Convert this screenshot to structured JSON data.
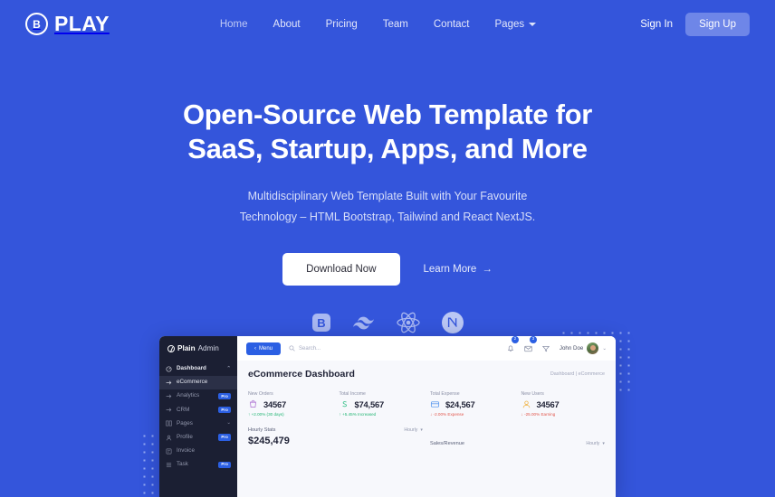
{
  "navbar": {
    "brand_mark": "B",
    "brand_text": "PLAY",
    "links": [
      {
        "label": "Home",
        "active": true
      },
      {
        "label": "About",
        "active": false
      },
      {
        "label": "Pricing",
        "active": false
      },
      {
        "label": "Team",
        "active": false
      },
      {
        "label": "Contact",
        "active": false
      },
      {
        "label": "Pages",
        "active": false,
        "has_caret": true
      }
    ],
    "sign_in": "Sign In",
    "sign_up": "Sign Up"
  },
  "hero": {
    "heading_line1": "Open-Source Web Template for",
    "heading_line2": "SaaS, Startup, Apps, and More",
    "sub_line1": "Multidisciplinary Web Template Built with Your Favourite",
    "sub_line2": "Technology – HTML Bootstrap, Tailwind and React NextJS.",
    "btn_download": "Download Now",
    "btn_learn": "Learn More",
    "btn_learn_arrow": "→",
    "tech_icons": [
      {
        "name": "bootstrap-icon",
        "glyph": "B"
      },
      {
        "name": "tailwind-icon",
        "glyph": "~"
      },
      {
        "name": "react-icon",
        "glyph": "atom"
      },
      {
        "name": "nextjs-icon",
        "glyph": "N"
      }
    ]
  },
  "dashboard": {
    "logo_main": "Plain",
    "logo_thin": "Admin",
    "sidebar": [
      {
        "label": "Dashboard",
        "icon": "grid-icon",
        "type": "head",
        "chev": "⌃"
      },
      {
        "label": "eCommerce",
        "icon": "arrow-right-icon",
        "type": "sel"
      },
      {
        "label": "Analytics",
        "icon": "arrow-right-icon",
        "badge": "Pro"
      },
      {
        "label": "CRM",
        "icon": "arrow-right-icon",
        "badge": "Pro"
      },
      {
        "label": "Pages",
        "icon": "pages-icon",
        "chev": "⌄"
      },
      {
        "label": "Profile",
        "icon": "user-icon",
        "badge": "Pro"
      },
      {
        "label": "Invoice",
        "icon": "invoice-icon"
      },
      {
        "label": "Task",
        "icon": "list-icon",
        "badge": "Pro"
      }
    ],
    "topbar": {
      "menu_label": "Menu",
      "menu_caret": "‹",
      "search_placeholder": "Search...",
      "bell_badge": "2",
      "mail_badge": "3",
      "user_name": "John Doe",
      "user_caret": "⌄"
    },
    "page_title": "eCommerce Dashboard",
    "breadcrumb": "Dashboard  |  eCommerce",
    "stats": [
      {
        "label": "New Orders",
        "value": "34567",
        "sub": "↑ +2.00% (30 days)",
        "dir": "up",
        "icon": "cart-icon",
        "color": "#B57FD6"
      },
      {
        "label": "Total Income",
        "value": "$74,567",
        "sub": "↑ +5.45% Increased",
        "dir": "up",
        "icon": "dollar-icon",
        "color": "#3FC38F"
      },
      {
        "label": "Total Expense",
        "value": "$24,567",
        "sub": "↓ -2.00% Expense",
        "dir": "down",
        "icon": "card-icon",
        "color": "#5E9BEE"
      },
      {
        "label": "New Users",
        "value": "34567",
        "sub": "↓ -25.00% Earning",
        "dir": "down",
        "icon": "users-icon",
        "color": "#F0B54A"
      }
    ],
    "bottom": [
      {
        "title": "Hourly Stats",
        "value": "$245,479",
        "select": "Hourly"
      },
      {
        "title": "Sales/Revenue",
        "value": "",
        "select": "Hourly"
      }
    ]
  },
  "colors": {
    "brand_blue": "#3455DB",
    "accent_blue": "#2B5FE3",
    "signup_btn": "#6E86E8",
    "sidebar_dark": "#1B1F33"
  }
}
